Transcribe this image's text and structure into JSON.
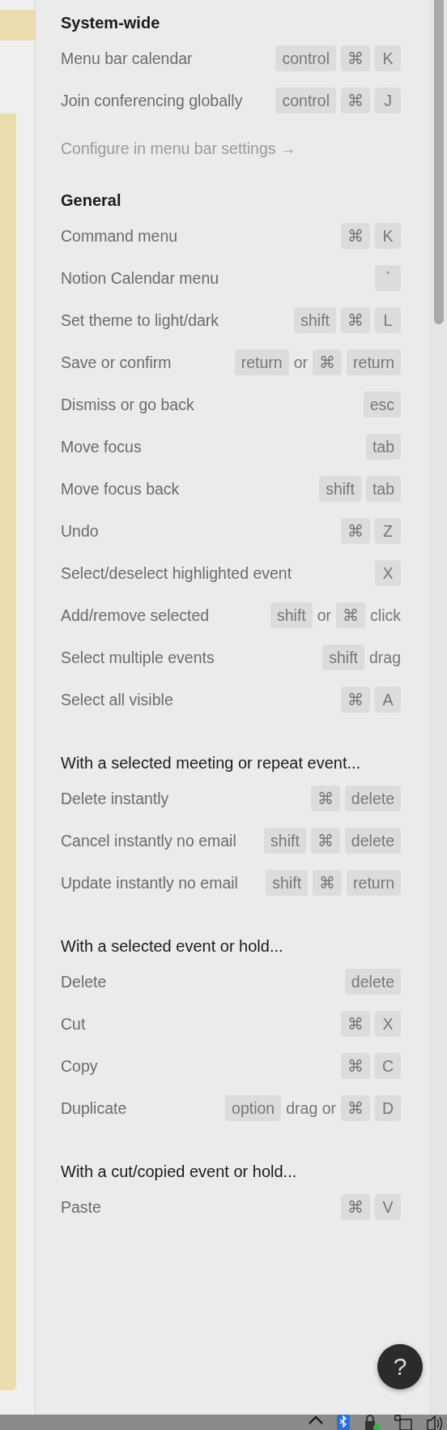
{
  "sections": [
    {
      "heading": "System-wide",
      "kind": "title",
      "rows": [
        {
          "label": "Menu bar calendar",
          "keys": [
            {
              "kind": "key",
              "text": "control"
            },
            {
              "kind": "key",
              "text": "⌘"
            },
            {
              "kind": "key",
              "text": "K"
            }
          ]
        },
        {
          "label": "Join conferencing globally",
          "keys": [
            {
              "kind": "key",
              "text": "control"
            },
            {
              "kind": "key",
              "text": "⌘"
            },
            {
              "kind": "key",
              "text": "J"
            }
          ]
        }
      ],
      "link": "Configure in menu bar settings →"
    },
    {
      "heading": "General",
      "kind": "title",
      "rows": [
        {
          "label": "Command menu",
          "keys": [
            {
              "kind": "key",
              "text": "⌘"
            },
            {
              "kind": "key",
              "text": "K"
            }
          ]
        },
        {
          "label": "Notion Calendar menu",
          "keys": [
            {
              "kind": "key",
              "text": "`"
            }
          ]
        },
        {
          "label": "Set theme to light/dark",
          "keys": [
            {
              "kind": "key",
              "text": "shift"
            },
            {
              "kind": "key",
              "text": "⌘"
            },
            {
              "kind": "key",
              "text": "L"
            }
          ]
        },
        {
          "label": "Save or confirm",
          "keys": [
            {
              "kind": "key",
              "text": "return"
            },
            {
              "kind": "word",
              "text": "or"
            },
            {
              "kind": "key",
              "text": "⌘"
            },
            {
              "kind": "key",
              "text": "return"
            }
          ]
        },
        {
          "label": "Dismiss or go back",
          "keys": [
            {
              "kind": "key",
              "text": "esc"
            }
          ]
        },
        {
          "label": "Move focus",
          "keys": [
            {
              "kind": "key",
              "text": "tab"
            }
          ]
        },
        {
          "label": "Move focus back",
          "keys": [
            {
              "kind": "key",
              "text": "shift"
            },
            {
              "kind": "key",
              "text": "tab"
            }
          ]
        },
        {
          "label": "Undo",
          "keys": [
            {
              "kind": "key",
              "text": "⌘"
            },
            {
              "kind": "key",
              "text": "Z"
            }
          ]
        },
        {
          "label": "Select/deselect highlighted event",
          "keys": [
            {
              "kind": "key",
              "text": "X"
            }
          ]
        },
        {
          "label": "Add/remove selected",
          "keys": [
            {
              "kind": "key",
              "text": "shift"
            },
            {
              "kind": "word",
              "text": "or"
            },
            {
              "kind": "key",
              "text": "⌘"
            },
            {
              "kind": "word",
              "text": "click"
            }
          ]
        },
        {
          "label": "Select multiple events",
          "keys": [
            {
              "kind": "key",
              "text": "shift"
            },
            {
              "kind": "word",
              "text": "drag"
            }
          ]
        },
        {
          "label": "Select all visible",
          "keys": [
            {
              "kind": "key",
              "text": "⌘"
            },
            {
              "kind": "key",
              "text": "A"
            }
          ]
        }
      ]
    },
    {
      "heading": "With a selected meeting or repeat event...",
      "kind": "subtitle",
      "rows": [
        {
          "label": "Delete instantly",
          "keys": [
            {
              "kind": "key",
              "text": "⌘"
            },
            {
              "kind": "key",
              "text": "delete"
            }
          ]
        },
        {
          "label": "Cancel instantly no email",
          "keys": [
            {
              "kind": "key",
              "text": "shift"
            },
            {
              "kind": "key",
              "text": "⌘"
            },
            {
              "kind": "key",
              "text": "delete"
            }
          ]
        },
        {
          "label": "Update instantly no email",
          "keys": [
            {
              "kind": "key",
              "text": "shift"
            },
            {
              "kind": "key",
              "text": "⌘"
            },
            {
              "kind": "key",
              "text": "return"
            }
          ]
        }
      ]
    },
    {
      "heading": "With a selected event or hold...",
      "kind": "subtitle",
      "rows": [
        {
          "label": "Delete",
          "keys": [
            {
              "kind": "key",
              "text": "delete"
            }
          ]
        },
        {
          "label": "Cut",
          "keys": [
            {
              "kind": "key",
              "text": "⌘"
            },
            {
              "kind": "key",
              "text": "X"
            }
          ]
        },
        {
          "label": "Copy",
          "keys": [
            {
              "kind": "key",
              "text": "⌘"
            },
            {
              "kind": "key",
              "text": "C"
            }
          ]
        },
        {
          "label": "Duplicate",
          "keys": [
            {
              "kind": "key",
              "text": "option"
            },
            {
              "kind": "word",
              "text": "drag or"
            },
            {
              "kind": "key",
              "text": "⌘"
            },
            {
              "kind": "key",
              "text": "D"
            }
          ]
        }
      ]
    },
    {
      "heading": "With a cut/copied event or hold...",
      "kind": "subtitle",
      "rows": [
        {
          "label": "Paste",
          "keys": [
            {
              "kind": "key",
              "text": "⌘"
            },
            {
              "kind": "key",
              "text": "V"
            }
          ]
        }
      ]
    }
  ],
  "help_button": "?"
}
